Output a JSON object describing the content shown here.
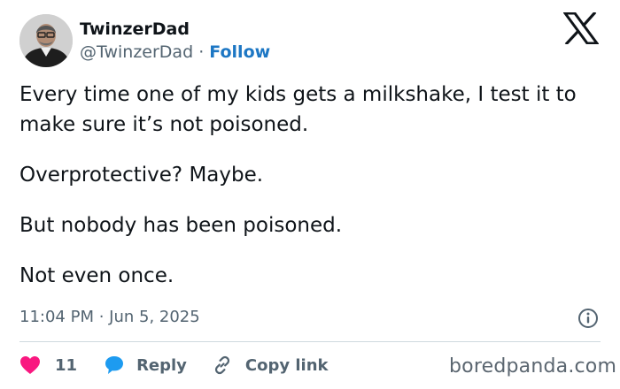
{
  "author": {
    "display_name": "TwinzerDad",
    "handle": "@TwinzerDad",
    "separator": "·",
    "follow_label": "Follow"
  },
  "tweet": {
    "paragraphs": [
      "Every time one of my kids gets a milkshake, I test it to make sure it’s not poisoned.",
      "Overprotective? Maybe.",
      "But nobody has been poisoned.",
      "Not even once."
    ],
    "timestamp": "11:04 PM · Jun 5, 2025"
  },
  "actions": {
    "like_count": "11",
    "reply_label": "Reply",
    "copy_link_label": "Copy link"
  },
  "icons": {
    "brand": "x-logo-icon",
    "info": "info-icon",
    "like": "heart-icon",
    "reply": "speech-bubble-icon",
    "link": "link-icon"
  },
  "colors": {
    "like": "#f91880",
    "reply": "#1d9bf0",
    "follow": "#1d77c4",
    "secondary_text": "#536471"
  },
  "watermark": "boredpanda.com"
}
